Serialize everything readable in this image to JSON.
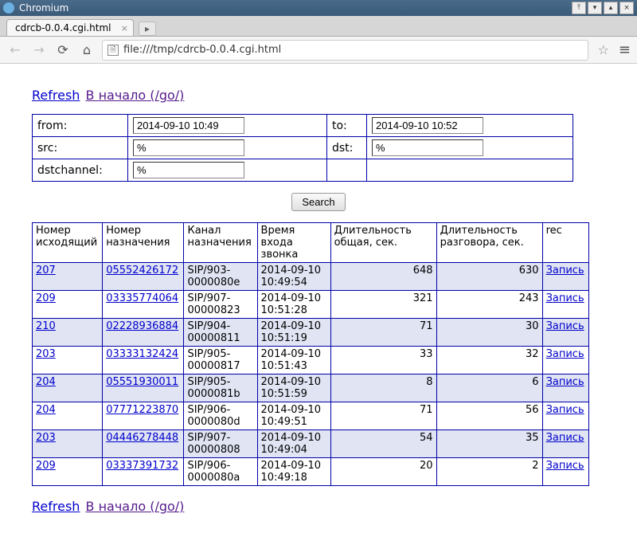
{
  "window": {
    "app_name": "Chromium"
  },
  "tab": {
    "title": "cdrcb-0.0.4.cgi.html"
  },
  "address_bar": {
    "url": "file:///tmp/cdrcb-0.0.4.cgi.html"
  },
  "links": {
    "refresh": "Refresh",
    "home": "В начало (/go/)"
  },
  "filter": {
    "from_label": "from:",
    "from_value": "2014-09-10 10:49",
    "to_label": "to:",
    "to_value": "2014-09-10 10:52",
    "src_label": "src:",
    "src_value": "%",
    "dst_label": "dst:",
    "dst_value": "%",
    "dstchannel_label": "dstchannel:",
    "dstchannel_value": "%"
  },
  "search_button": "Search",
  "columns": {
    "src": "Номер исходящий",
    "dst": "Номер назначения",
    "chan": "Канал назначения",
    "time": "Время входа звонка",
    "dur_total": "Длительность общая, сек.",
    "dur_talk": "Длительность разговора, сек.",
    "rec": "rec"
  },
  "rec_label": "Запись",
  "rows": [
    {
      "src": "207",
      "dst": "05552426172",
      "chan": "SIP/903-0000080e",
      "time": "2014-09-10 10:49:54",
      "dur_total": "648",
      "dur_talk": "630"
    },
    {
      "src": "209",
      "dst": "03335774064",
      "chan": "SIP/907-00000823",
      "time": "2014-09-10 10:51:28",
      "dur_total": "321",
      "dur_talk": "243"
    },
    {
      "src": "210",
      "dst": "02228936884",
      "chan": "SIP/904-00000811",
      "time": "2014-09-10 10:51:19",
      "dur_total": "71",
      "dur_talk": "30"
    },
    {
      "src": "203",
      "dst": "03333132424",
      "chan": "SIP/905-00000817",
      "time": "2014-09-10 10:51:43",
      "dur_total": "33",
      "dur_talk": "32"
    },
    {
      "src": "204",
      "dst": "05551930011",
      "chan": "SIP/905-0000081b",
      "time": "2014-09-10 10:51:59",
      "dur_total": "8",
      "dur_talk": "6"
    },
    {
      "src": "204",
      "dst": "07771223870",
      "chan": "SIP/906-0000080d",
      "time": "2014-09-10 10:49:51",
      "dur_total": "71",
      "dur_talk": "56"
    },
    {
      "src": "203",
      "dst": "04446278448",
      "chan": "SIP/907-00000808",
      "time": "2014-09-10 10:49:04",
      "dur_total": "54",
      "dur_talk": "35"
    },
    {
      "src": "209",
      "dst": "03337391732",
      "chan": "SIP/906-0000080a",
      "time": "2014-09-10 10:49:18",
      "dur_total": "20",
      "dur_talk": "2"
    }
  ]
}
